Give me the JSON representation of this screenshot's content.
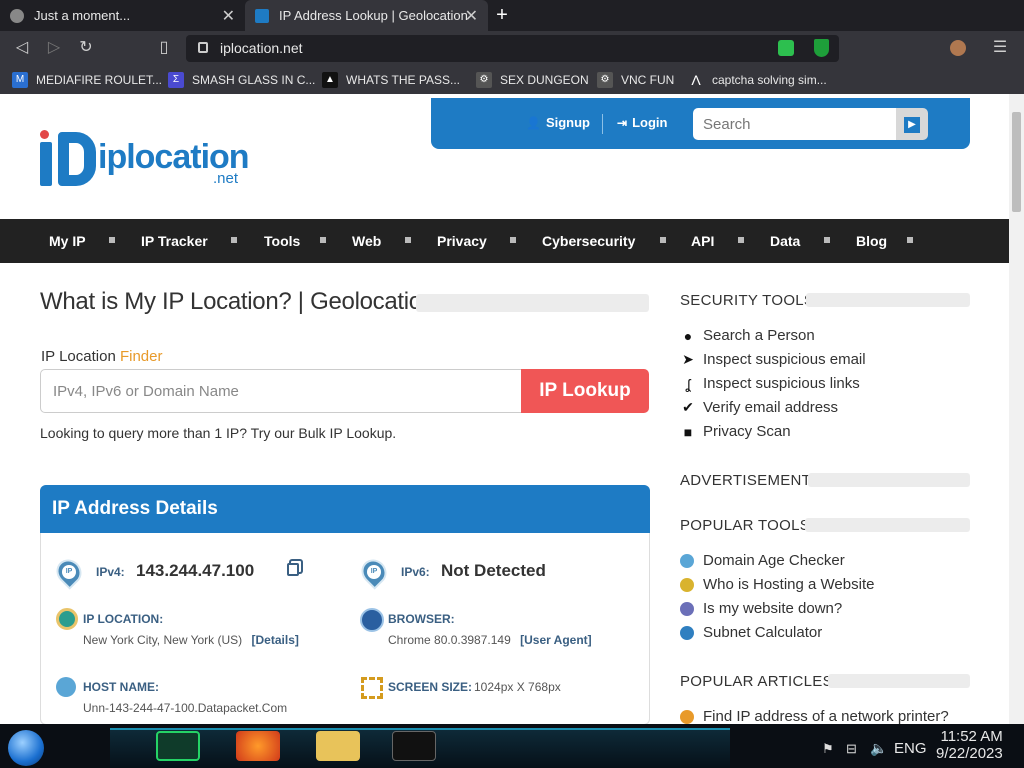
{
  "browser": {
    "tabs": [
      {
        "title": "Just a moment...",
        "active": false
      },
      {
        "title": "IP Address Lookup | Geolocation",
        "active": true
      }
    ],
    "new_tab": "+",
    "url": "iplocation.net",
    "bookmarks": [
      {
        "label": "MEDIAFIRE ROULET...",
        "icon": "mediafire-icon"
      },
      {
        "label": "SMASH GLASS IN C...",
        "icon": "bookmark-icon"
      },
      {
        "label": "WHATS THE PASS...",
        "icon": "bookmark-icon"
      },
      {
        "label": "SEX DUNGEON",
        "icon": "bookmark-icon"
      },
      {
        "label": "VNC FUN",
        "icon": "bookmark-icon"
      },
      {
        "label": "captcha solving sim...",
        "icon": "bookmark-icon"
      }
    ]
  },
  "site": {
    "logo_main": "iplocation",
    "logo_suffix": ".net",
    "logo_ip": "iP",
    "signup": "Signup",
    "login": "Login",
    "search_placeholder": "Search",
    "nav": [
      "My IP",
      "IP Tracker",
      "Tools",
      "Web",
      "Privacy",
      "Cybersecurity",
      "API",
      "Data",
      "Blog"
    ]
  },
  "main": {
    "title": "What is My IP Location? | Geolocation",
    "finder_label": "IP Location",
    "finder_highlight": "Finder",
    "input_placeholder": "IPv4, IPv6 or Domain Name",
    "lookup_button": "IP Lookup",
    "bulk_text": "Looking to query more than 1 IP? Try our Bulk IP Lookup.",
    "details": {
      "heading": "IP Address Details",
      "ipv4_label": "IPv4:",
      "ipv4_value": "143.244.47.100",
      "ipv6_label": "IPv6:",
      "ipv6_value": "Not Detected",
      "location_label": "IP LOCATION:",
      "location_value": "New York City, New York (US)",
      "location_link": "[Details]",
      "browser_label": "BROWSER:",
      "browser_value": "Chrome 80.0.3987.149",
      "browser_link": "[User Agent]",
      "host_label": "HOST NAME:",
      "host_value": "Unn-143-244-47-100.Datapacket.Com",
      "screen_label": "SCREEN SIZE:",
      "screen_value": "1024px X 768px"
    }
  },
  "sidebar": {
    "security_heading": "SECURITY TOOLS",
    "security_items": [
      {
        "label": "Search a Person",
        "icon": "person-icon"
      },
      {
        "label": "Inspect suspicious email",
        "icon": "paper-plane-icon"
      },
      {
        "label": "Inspect suspicious links",
        "icon": "hook-icon"
      },
      {
        "label": "Verify email address",
        "icon": "check-icon"
      },
      {
        "label": "Privacy Scan",
        "icon": "lock-icon"
      }
    ],
    "ad_heading": "ADVERTISEMENT",
    "popular_heading": "POPULAR TOOLS",
    "popular_items": [
      {
        "label": "Domain Age Checker",
        "color": "#5aa6d6"
      },
      {
        "label": "Who is Hosting a Website",
        "color": "#d9b32e"
      },
      {
        "label": "Is my website down?",
        "color": "#6b6fb8"
      },
      {
        "label": "Subnet Calculator",
        "color": "#2f7fc0"
      }
    ],
    "articles_heading": "POPULAR ARTICLES",
    "article_items": [
      {
        "label": "Find IP address of a network printer?",
        "color": "#e89a2a"
      }
    ]
  },
  "taskbar": {
    "lang": "ENG",
    "time": "11:52 AM",
    "date": "9/22/2023"
  },
  "colors": {
    "brand_blue": "#1e7bc4",
    "lookup_red": "#f05656",
    "accent_orange": "#e89a2a",
    "nav_dark": "#222222"
  }
}
